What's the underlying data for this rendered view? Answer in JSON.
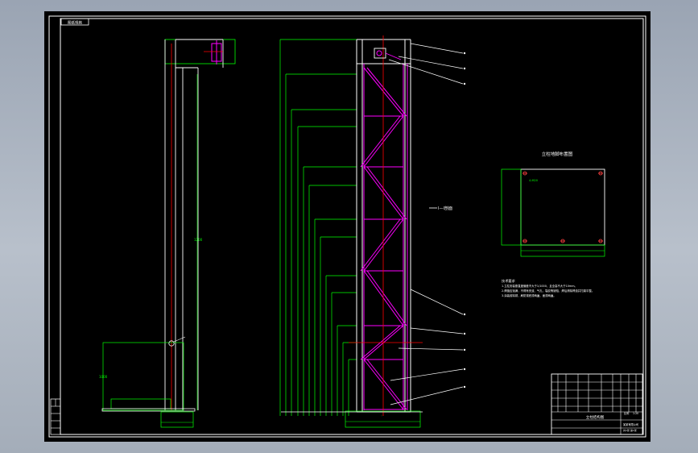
{
  "drawing": {
    "corner_tag": "图纸规格",
    "detail_title": "立柱地脚布置图",
    "notes_heading": "技术要求",
    "notes": [
      "1.立柱安装垂直度偏差不大于1/1000，且全高不大于10mm。",
      "2.焊缝应饱满，不得有夹渣、气孔、裂纹等缺陷，焊后清除焊渣并打磨平整。",
      "3.涂装前除锈，刷防锈底漆两遍，面漆两遍。"
    ],
    "section_callout": "I—I剖面",
    "left_elevation_dim_upper": "1200",
    "left_elevation_dim_lower": "1000"
  },
  "title_block": {
    "drawing_name": "立柱结构图",
    "scale_label": "比例",
    "scale_value": "1:20",
    "company": "某某有限公司",
    "sheet": "共1张 第1张"
  },
  "colors": {
    "frame": "#ffffff",
    "dimension": "#00ff00",
    "structure": "#ffffff",
    "centerline": "#ff0000",
    "bracing": "#ff00ff",
    "leader": "#ffffff"
  }
}
